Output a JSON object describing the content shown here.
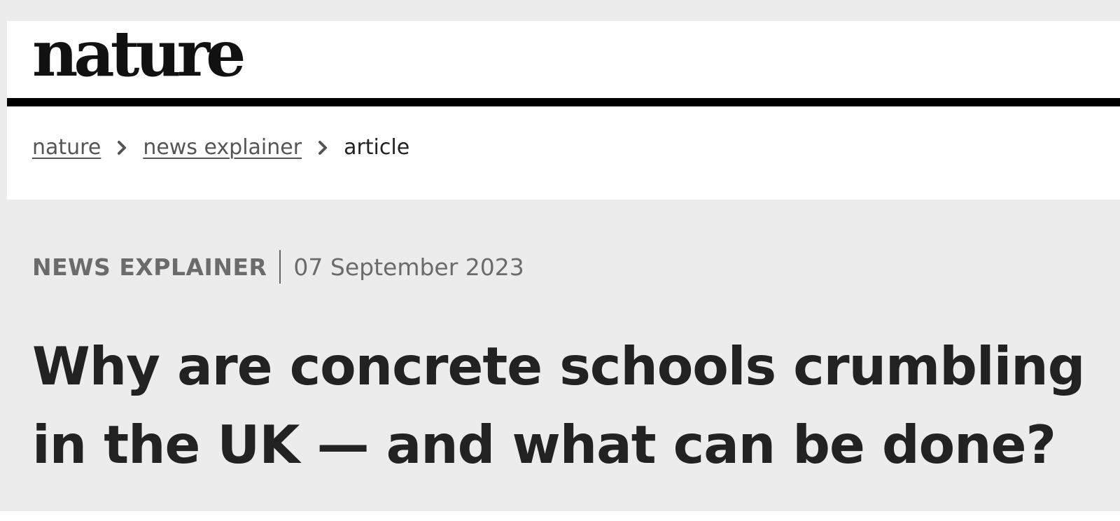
{
  "header": {
    "logo_text": "nature"
  },
  "breadcrumb": {
    "items": [
      {
        "label": "nature"
      },
      {
        "label": "news explainer"
      },
      {
        "label": "article"
      }
    ],
    "separator_icon": "chevron-right-icon"
  },
  "article": {
    "type": "NEWS EXPLAINER",
    "date": "07 September 2023",
    "title": "Why are concrete schools crumbling in the UK — and what can be done?"
  },
  "colors": {
    "background_gray": "#ececec",
    "header_white": "#ffffff",
    "rule_black": "#000000",
    "meta_gray": "#6b6b6b",
    "title_dark": "#222222"
  }
}
